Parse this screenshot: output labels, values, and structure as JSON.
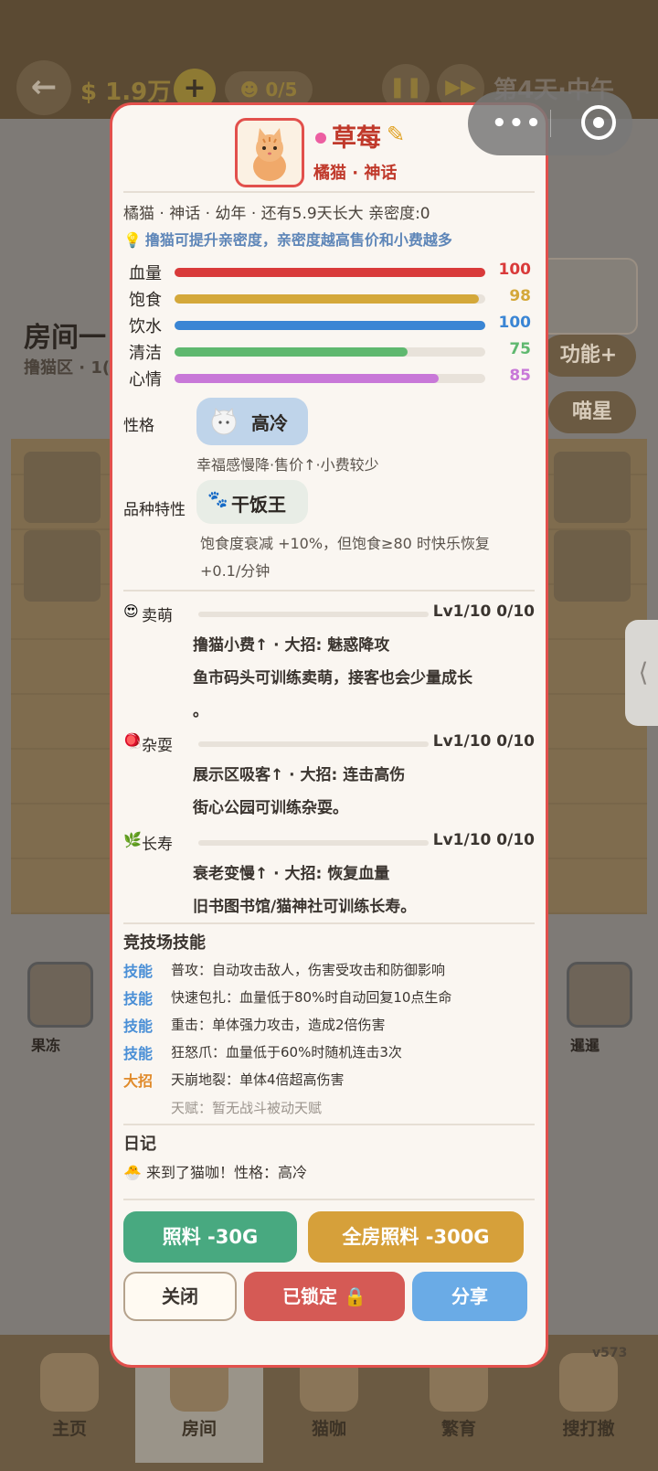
{
  "background": {
    "back_icon": "←",
    "coins": "1.9万",
    "add_icon": "+",
    "cat_count": "0/5",
    "speed_hint": "1",
    "day": "第4天·中午",
    "room_title": "房间一",
    "room_sub": "撸猫区 · 1(",
    "function_btn": "功能+",
    "miaoxing_btn": "喵星",
    "side_handle": "⟨",
    "cat_left_name": "果冻",
    "cat_right_name": "暹暹",
    "version": "v573"
  },
  "nav": {
    "items": [
      {
        "label": "主页"
      },
      {
        "label": "房间"
      },
      {
        "label": "猫咖"
      },
      {
        "label": "繁育"
      },
      {
        "label": "搜打撤"
      }
    ]
  },
  "capsule": {
    "dots": "•••"
  },
  "cat": {
    "name": "草莓",
    "edit_icon": "✎",
    "breed_line": "橘猫 · 神话",
    "info": "橘猫 · 神话 · 幼年 · 还有5.9天长大   亲密度:0",
    "tip_icon": "💡",
    "tip": "撸猫可提升亲密度，亲密度越高售价和小费越多"
  },
  "stats": [
    {
      "label": "血量",
      "value": 100,
      "color": "#d93a3a"
    },
    {
      "label": "饱食",
      "value": 98,
      "color": "#d4a83a"
    },
    {
      "label": "饮水",
      "value": 100,
      "color": "#3a85d4"
    },
    {
      "label": "清洁",
      "value": 75,
      "color": "#5fb86f"
    },
    {
      "label": "心情",
      "value": 85,
      "color": "#c878d8"
    }
  ],
  "personality": {
    "label": "性格",
    "tag": "高冷",
    "desc": "幸福感慢降·售价↑·小费较少"
  },
  "trait": {
    "label": "品种特性",
    "icon": "🐾",
    "tag": "干饭王",
    "desc_line1": "饱食度衰减 +10%，但饱食≥80 时快乐恢复",
    "desc_line2": "+0.1/分钟"
  },
  "skills": [
    {
      "emoji": "😍",
      "name": "卖萌",
      "level": "Lv1/10 0/10",
      "progress": 0,
      "line1": "撸猫小费↑ · 大招: 魅惑降攻",
      "line2": "鱼市码头可训练卖萌，接客也会少量成长",
      "line3": "。"
    },
    {
      "emoji": "🪀",
      "name": "杂耍",
      "level": "Lv1/10 0/10",
      "progress": 0,
      "line1": "展示区吸客↑ · 大招: 连击高伤",
      "line2": "街心公园可训练杂耍。",
      "line3": ""
    },
    {
      "emoji": "🌿",
      "name": "长寿",
      "level": "Lv1/10 0/10",
      "progress": 0,
      "line1": "衰老变慢↑ · 大招: 恢复血量",
      "line2": "旧书图书馆/猫神社可训练长寿。",
      "line3": ""
    }
  ],
  "arena": {
    "title": "竞技场技能",
    "rows": [
      {
        "tag": "技能",
        "color": "#4a8fd6",
        "text": "普攻：自动攻击敌人，伤害受攻击和防御影响"
      },
      {
        "tag": "技能",
        "color": "#4a8fd6",
        "text": "快速包扎：血量低于80%时自动回复10点生命"
      },
      {
        "tag": "技能",
        "color": "#4a8fd6",
        "text": "重击：单体强力攻击，造成2倍伤害"
      },
      {
        "tag": "技能",
        "color": "#4a8fd6",
        "text": "狂怒爪：血量低于60%时随机连击3次"
      },
      {
        "tag": "大招",
        "color": "#e08a2a",
        "text": "天崩地裂：单体4倍超高伤害"
      }
    ],
    "talent": "天赋：暂无战斗被动天赋"
  },
  "diary": {
    "title": "日记",
    "icon": "🐣",
    "entry": "来到了猫咖！性格：高冷"
  },
  "actions": {
    "feed": "照料 -30G",
    "feed_all": "全房照料 -300G",
    "close": "关闭",
    "locked": "已锁定 🔒",
    "share": "分享"
  }
}
